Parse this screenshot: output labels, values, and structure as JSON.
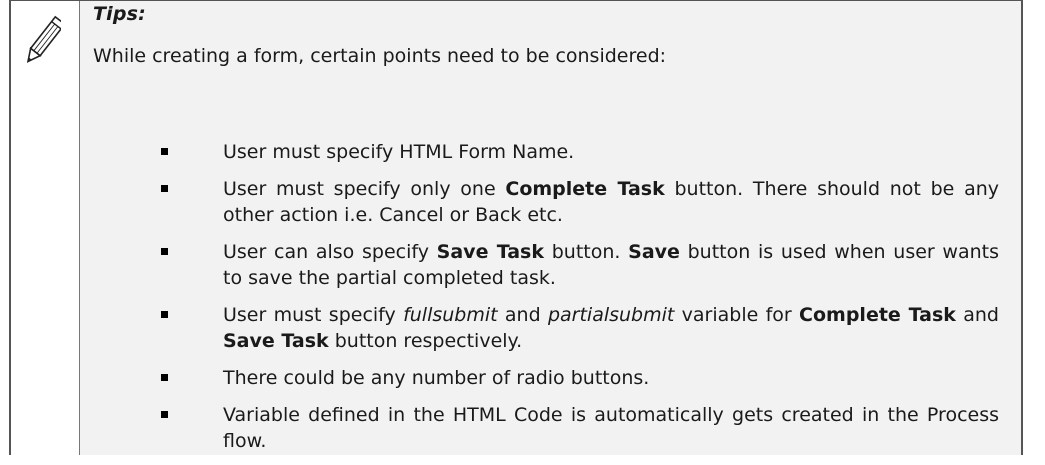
{
  "tips": {
    "title": "Tips:",
    "intro": "While creating a form, certain points need to be considered:",
    "items": [
      {
        "parts": [
          {
            "text": "User must specify HTML Form Name.",
            "style": "normal"
          }
        ]
      },
      {
        "parts": [
          {
            "text": "User must specify only one ",
            "style": "normal"
          },
          {
            "text": "Complete Task",
            "style": "bold"
          },
          {
            "text": " button. There should not be any other action i.e. Cancel or Back etc.",
            "style": "normal"
          }
        ]
      },
      {
        "parts": [
          {
            "text": "User can also specify ",
            "style": "normal"
          },
          {
            "text": "Save Task",
            "style": "bold"
          },
          {
            "text": " button. ",
            "style": "normal"
          },
          {
            "text": "Save",
            "style": "bold"
          },
          {
            "text": " button is used when user wants to save the partial completed task.",
            "style": "normal"
          }
        ]
      },
      {
        "parts": [
          {
            "text": "User must specify ",
            "style": "normal"
          },
          {
            "text": "fullsubmit",
            "style": "italic"
          },
          {
            "text": " and ",
            "style": "normal"
          },
          {
            "text": "partialsubmit",
            "style": "italic"
          },
          {
            "text": " variable for ",
            "style": "normal"
          },
          {
            "text": "Complete Task",
            "style": "bold"
          },
          {
            "text": " and ",
            "style": "normal"
          },
          {
            "text": "Save Task",
            "style": "bold"
          },
          {
            "text": " button respectively.",
            "style": "normal"
          }
        ]
      },
      {
        "parts": [
          {
            "text": "There could be any number of radio buttons.",
            "style": "normal"
          }
        ]
      },
      {
        "parts": [
          {
            "text": "Variable defined in the HTML Code is automatically gets created in the Process flow.",
            "style": "normal"
          }
        ]
      }
    ]
  },
  "icon": "pencil-icon",
  "colors": {
    "content_background": "#f2f2f2",
    "border": "#555555"
  }
}
